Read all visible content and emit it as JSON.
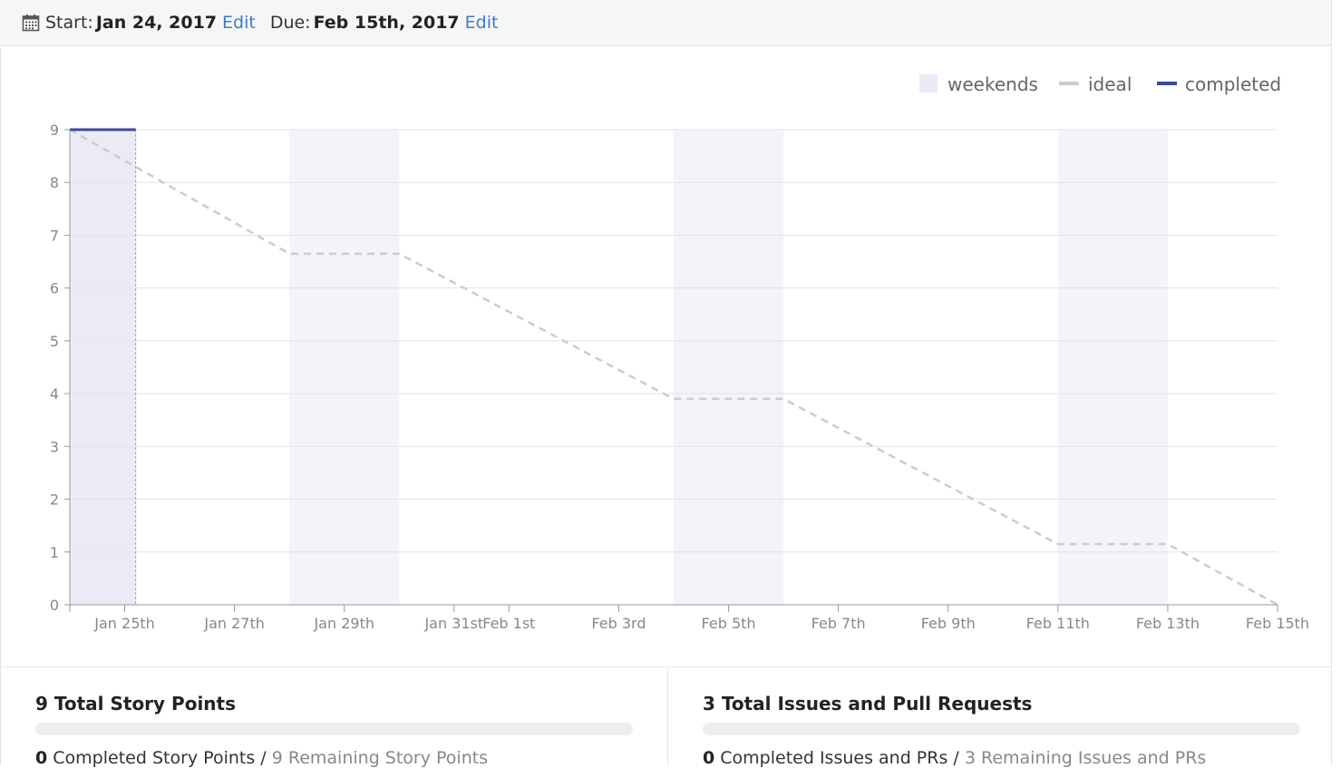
{
  "header": {
    "start_label": "Start:",
    "start_value": "Jan 24, 2017",
    "start_edit": "Edit",
    "due_label": "Due:",
    "due_value": "Feb 15th, 2017",
    "due_edit": "Edit",
    "icon": "calendar-icon",
    "link_color": "#3f7bbf"
  },
  "legend": {
    "weekends": "weekends",
    "ideal": "ideal",
    "completed": "completed"
  },
  "colors": {
    "weekend": "#f3f3fa",
    "ideal": "#cccccc",
    "completed": "#3f4a96",
    "today_marker": "#9b8cf2"
  },
  "chart_data": {
    "type": "line",
    "title": "",
    "xlabel": "",
    "ylabel": "",
    "x_start": "2017-01-24",
    "x_end": "2017-02-15",
    "ylim": [
      0,
      9
    ],
    "y_ticks": [
      0,
      1,
      2,
      3,
      4,
      5,
      6,
      7,
      8,
      9
    ],
    "x_tick_labels": [
      "Jan 25th",
      "Jan 27th",
      "Jan 29th",
      "Jan 31st",
      "Feb 1st",
      "Feb 3rd",
      "Feb 5th",
      "Feb 7th",
      "Feb 9th",
      "Feb 11th",
      "Feb 13th",
      "Feb 15th"
    ],
    "x_tick_dates": [
      "2017-01-25",
      "2017-01-27",
      "2017-01-29",
      "2017-01-31",
      "2017-02-01",
      "2017-02-03",
      "2017-02-05",
      "2017-02-07",
      "2017-02-09",
      "2017-02-11",
      "2017-02-13",
      "2017-02-15"
    ],
    "weekends": [
      [
        "2017-01-28",
        "2017-01-30"
      ],
      [
        "2017-02-04",
        "2017-02-06"
      ],
      [
        "2017-02-11",
        "2017-02-13"
      ]
    ],
    "series": [
      {
        "name": "ideal",
        "dashed": true,
        "points": [
          [
            "2017-01-24",
            9
          ],
          [
            "2017-01-28",
            6.65
          ],
          [
            "2017-01-30",
            6.65
          ],
          [
            "2017-02-04",
            3.9
          ],
          [
            "2017-02-06",
            3.9
          ],
          [
            "2017-02-11",
            1.15
          ],
          [
            "2017-02-13",
            1.15
          ],
          [
            "2017-02-15",
            0
          ]
        ]
      },
      {
        "name": "completed",
        "dashed": false,
        "points": [
          [
            "2017-01-24",
            9
          ],
          [
            "2017-01-25.2",
            9
          ]
        ]
      }
    ],
    "today": "2017-01-25.2",
    "grid": true,
    "legend_position": "top-right"
  },
  "stats": {
    "points": {
      "title": "9 Total Story Points",
      "completed_count": "0",
      "completed_label": " Completed Story Points / ",
      "remaining": "9 Remaining Story Points",
      "progress": 0
    },
    "issues": {
      "title": "3 Total Issues and Pull Requests",
      "completed_count": "0",
      "completed_label": " Completed Issues and PRs / ",
      "remaining": "3 Remaining Issues and PRs",
      "progress": 0
    }
  }
}
